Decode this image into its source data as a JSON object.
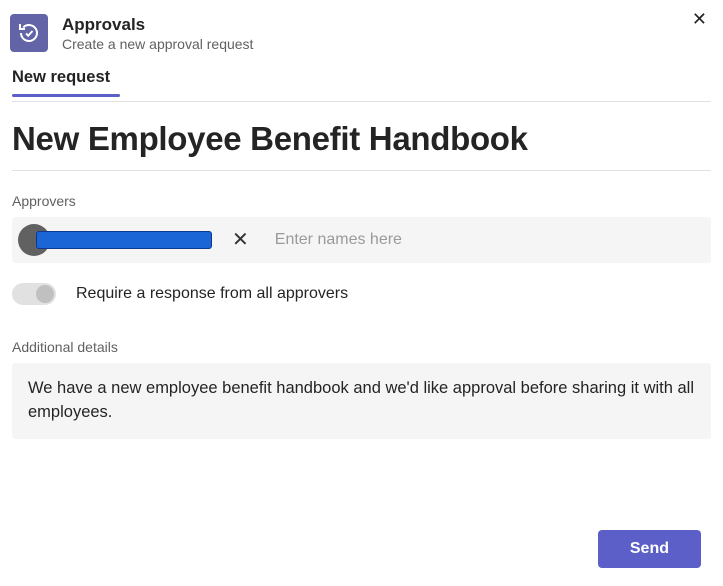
{
  "header": {
    "title": "Approvals",
    "subtitle": "Create a new approval request",
    "icon_name": "approvals-icon"
  },
  "tabs": {
    "active": {
      "label": "New request"
    }
  },
  "page": {
    "title": "New Employee Benefit Handbook"
  },
  "approvers": {
    "label": "Approvers",
    "input_placeholder": "Enter names here",
    "chip_name": "(redacted)"
  },
  "require_response": {
    "label": "Require a response from all approvers",
    "value": false
  },
  "additional_details": {
    "label": "Additional details",
    "value": "We have a new employee benefit handbook and we'd like approval before sharing it with all employees."
  },
  "buttons": {
    "send": "Send"
  }
}
